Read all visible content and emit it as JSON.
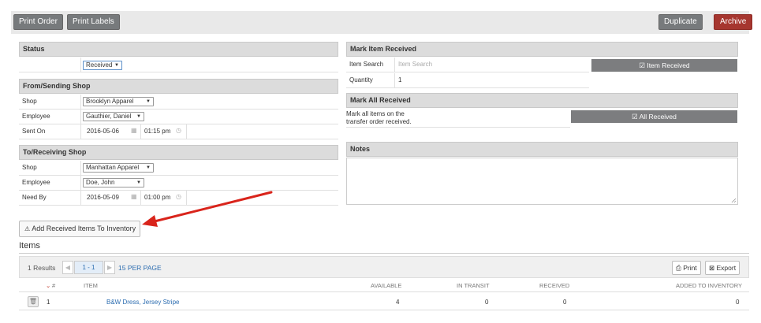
{
  "toolbar": {
    "print_order": "Print Order",
    "print_labels": "Print Labels",
    "duplicate": "Duplicate",
    "archive": "Archive"
  },
  "status": {
    "header": "Status",
    "value": "Received"
  },
  "from": {
    "header": "From/Sending Shop",
    "shop_label": "Shop",
    "shop_value": "Brooklyn Apparel",
    "employee_label": "Employee",
    "employee_value": "Gauthier, Daniel",
    "sent_label": "Sent On",
    "sent_date": "2016-05-06",
    "sent_time": "01:15 pm"
  },
  "to": {
    "header": "To/Receiving Shop",
    "shop_label": "Shop",
    "shop_value": "Manhattan Apparel",
    "employee_label": "Employee",
    "employee_value": "Doe, John",
    "need_label": "Need By",
    "need_date": "2016-05-09",
    "need_time": "01:00 pm"
  },
  "mark_item": {
    "header": "Mark Item Received",
    "search_label": "Item Search",
    "search_placeholder": "Item Search",
    "qty_label": "Quantity",
    "qty_value": "1",
    "button": "Item Received"
  },
  "mark_all": {
    "header": "Mark All Received",
    "desc_line1": "Mark all items on the",
    "desc_line2": "transfer order received.",
    "button": "All Received"
  },
  "notes": {
    "header": "Notes"
  },
  "add_button": "Add Received Items To Inventory",
  "items": {
    "title": "Items",
    "results": "1 Results",
    "page": "1 - 1",
    "per_page": "15 PER PAGE",
    "print": "Print",
    "export": "Export",
    "columns": {
      "num": "#",
      "item": "ITEM",
      "available": "AVAILABLE",
      "in_transit": "IN TRANSIT",
      "received": "RECEIVED",
      "added": "ADDED TO INVENTORY"
    },
    "rows": [
      {
        "num": "1",
        "item": "B&W Dress, Jersey Stripe",
        "available": "4",
        "in_transit": "0",
        "received": "0",
        "added": "0"
      }
    ]
  },
  "colors": {
    "archive": "#a6362f",
    "button_grey": "#777a7c",
    "link": "#2b6cb0",
    "annotation_arrow": "#d9241b"
  },
  "icons": [
    "check-icon",
    "calendar-icon",
    "clock-icon",
    "warning-icon",
    "print-icon",
    "export-icon",
    "trash-icon",
    "sort-down-icon",
    "prev-page-icon",
    "next-page-icon"
  ]
}
